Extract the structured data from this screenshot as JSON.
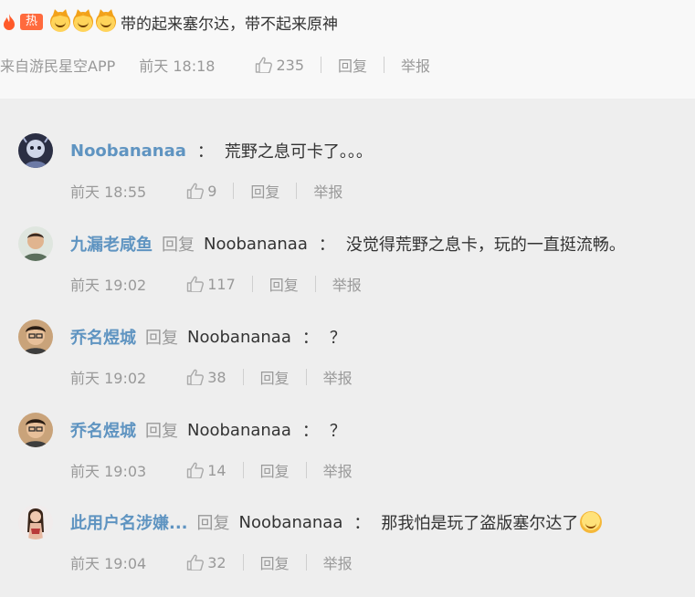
{
  "top_comment": {
    "hot_badge": "热",
    "text": "带的起来塞尔达，带不起来原神",
    "source": "来自游民星空APP",
    "time": "前天 18:18",
    "likes": "235",
    "reply_label": "回复",
    "report_label": "举报"
  },
  "replies": [
    {
      "username": "Noobananaa",
      "reply_word": "",
      "reply_to": "",
      "text": "荒野之息可卡了。。。",
      "time": "前天 18:55",
      "likes": "9",
      "reply_label": "回复",
      "report_label": "举报"
    },
    {
      "username": "九漏老咸鱼",
      "reply_word": "回复",
      "reply_to": "Noobananaa",
      "text": "没觉得荒野之息卡，玩的一直挺流畅。",
      "time": "前天 19:02",
      "likes": "117",
      "reply_label": "回复",
      "report_label": "举报"
    },
    {
      "username": "乔名煜城",
      "reply_word": "回复",
      "reply_to": "Noobananaa",
      "text": "？",
      "time": "前天 19:02",
      "likes": "38",
      "reply_label": "回复",
      "report_label": "举报"
    },
    {
      "username": "乔名煜城",
      "reply_word": "回复",
      "reply_to": "Noobananaa",
      "text": "？",
      "time": "前天 19:03",
      "likes": "14",
      "reply_label": "回复",
      "report_label": "举报"
    },
    {
      "username": "此用户名涉嫌...",
      "reply_word": "回复",
      "reply_to": "Noobananaa",
      "text": "那我怕是玩了盗版塞尔达了",
      "time": "前天 19:04",
      "likes": "32",
      "reply_label": "回复",
      "report_label": "举报"
    }
  ],
  "colors": {
    "username": "#5f94c1",
    "hot_badge": "#ff6a3d",
    "meta": "#999999",
    "reply_bg": "#eeeeee"
  },
  "icons": {
    "like": "thumbs-up-icon",
    "hot": "flame-icon",
    "emoji": "doge-emoji-icon"
  }
}
